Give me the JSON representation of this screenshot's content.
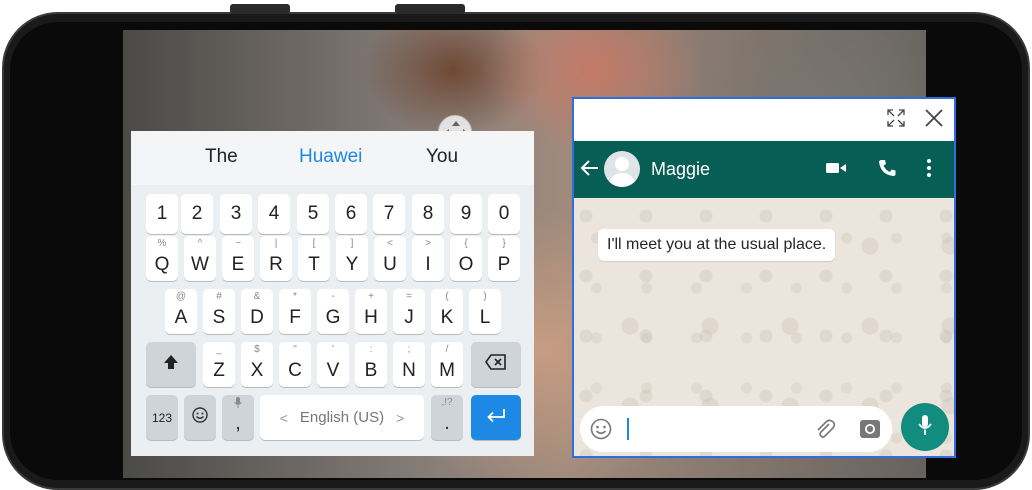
{
  "keyboard": {
    "suggestions": [
      "The",
      "Huawei",
      "You"
    ],
    "number_row": [
      "1",
      "2",
      "3",
      "4",
      "5",
      "6",
      "7",
      "8",
      "9",
      "0"
    ],
    "row1": [
      {
        "main": "Q",
        "sub": "%"
      },
      {
        "main": "W",
        "sub": "^"
      },
      {
        "main": "E",
        "sub": "~"
      },
      {
        "main": "R",
        "sub": "|"
      },
      {
        "main": "T",
        "sub": "["
      },
      {
        "main": "Y",
        "sub": "]"
      },
      {
        "main": "U",
        "sub": "<"
      },
      {
        "main": "I",
        "sub": ">"
      },
      {
        "main": "O",
        "sub": "{"
      },
      {
        "main": "P",
        "sub": "}"
      }
    ],
    "row2": [
      {
        "main": "A",
        "sub": "@"
      },
      {
        "main": "S",
        "sub": "#"
      },
      {
        "main": "D",
        "sub": "&"
      },
      {
        "main": "F",
        "sub": "*"
      },
      {
        "main": "G",
        "sub": "-"
      },
      {
        "main": "H",
        "sub": "+"
      },
      {
        "main": "J",
        "sub": "="
      },
      {
        "main": "K",
        "sub": "("
      },
      {
        "main": "L",
        "sub": ")"
      }
    ],
    "row3": [
      {
        "main": "Z",
        "sub": "_"
      },
      {
        "main": "X",
        "sub": "$"
      },
      {
        "main": "C",
        "sub": "\""
      },
      {
        "main": "V",
        "sub": "'"
      },
      {
        "main": "B",
        "sub": ":"
      },
      {
        "main": "N",
        "sub": ";"
      },
      {
        "main": "M",
        "sub": "/"
      }
    ],
    "numbers_key": "123",
    "comma_key": ",",
    "comma_sub": "🎤",
    "space_label": "English (US)",
    "space_left": "<",
    "space_right": ">",
    "period_key": ".",
    "period_sub": ",!?",
    "accent_color": "#1e88e5"
  },
  "chat": {
    "contact_name": "Maggie",
    "message": "I'll meet you at the usual place.",
    "header_color": "#075e54",
    "mic_color": "#128c7e"
  },
  "icons": {
    "expand": "expand-icon",
    "close": "close-icon",
    "back": "back-arrow-icon",
    "video": "video-call-icon",
    "call": "phone-call-icon",
    "menu": "more-vertical-icon",
    "emoji": "emoji-icon",
    "attach": "paperclip-icon",
    "camera": "camera-icon",
    "mic": "microphone-icon",
    "shift": "shift-icon",
    "backspace": "backspace-icon",
    "enter": "enter-icon",
    "pan": "move-handle-icon"
  }
}
